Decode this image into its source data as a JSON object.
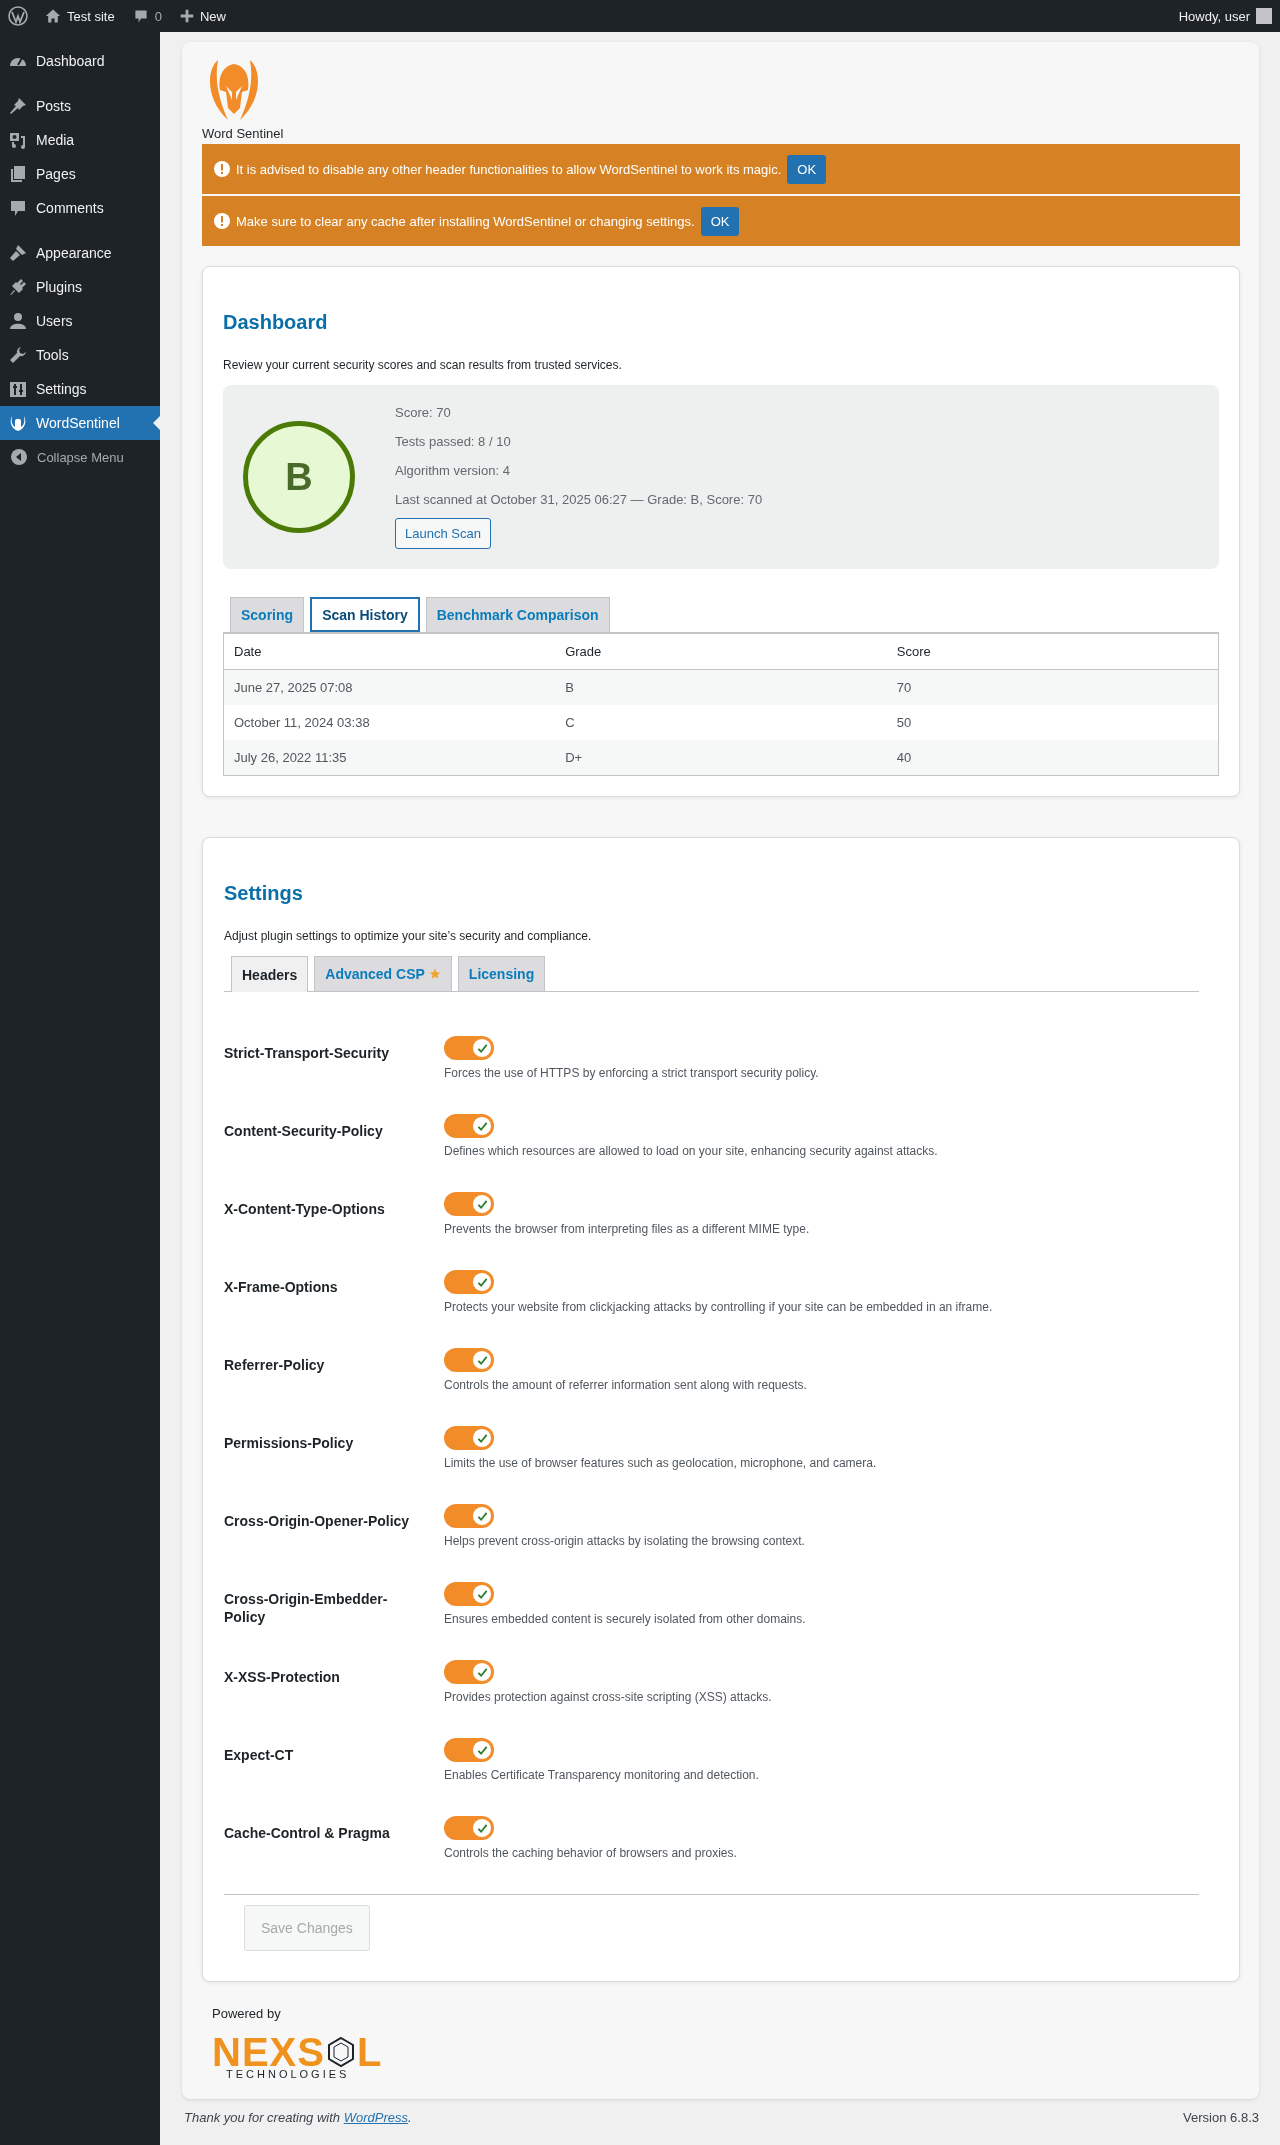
{
  "admin_bar": {
    "site": "Test site",
    "comments": "0",
    "new": "New",
    "greeting": "Howdy, user"
  },
  "sidebar": {
    "groups": [
      [
        {
          "label": "Dashboard",
          "selected": false
        }
      ],
      [
        {
          "label": "Posts",
          "selected": false
        },
        {
          "label": "Media",
          "selected": false
        },
        {
          "label": "Pages",
          "selected": false
        },
        {
          "label": "Comments",
          "selected": false
        }
      ],
      [
        {
          "label": "Appearance",
          "selected": false
        },
        {
          "label": "Plugins",
          "selected": false
        },
        {
          "label": "Users",
          "selected": false
        },
        {
          "label": "Tools",
          "selected": false
        },
        {
          "label": "Settings",
          "selected": false
        },
        {
          "label": "WordSentinel",
          "selected": true
        }
      ]
    ],
    "collapse": "Collapse Menu"
  },
  "brand": {
    "name": "Word Sentinel"
  },
  "notices": [
    {
      "text": "It is advised to disable any other header functionalities to allow WordSentinel to work its magic.",
      "button": "OK"
    },
    {
      "text": "Make sure to clear any cache after installing WordSentinel or changing settings.",
      "button": "OK"
    }
  ],
  "dashboard": {
    "title": "Dashboard",
    "description": "Review your current security scores and scan results from trusted services.",
    "grade": "B",
    "details": [
      "Score: 70",
      "Tests passed: 8 / 10",
      "Algorithm version: 4",
      "Last scanned at October 31, 2025 06:27 — Grade: B, Score: 70"
    ],
    "scan_button": "Launch Scan",
    "tabs": [
      {
        "label": "Scoring",
        "selected": false
      },
      {
        "label": "Scan History",
        "selected": true
      },
      {
        "label": "Benchmark Comparison",
        "selected": false
      }
    ],
    "table": {
      "columns": [
        "Date",
        "Grade",
        "Score"
      ],
      "rows": [
        [
          "June 27, 2025 07:08",
          "B",
          "70"
        ],
        [
          "October 11, 2024 03:38",
          "C",
          "50"
        ],
        [
          "July 26, 2022 11:35",
          "D+",
          "40"
        ]
      ]
    }
  },
  "settings": {
    "title": "Settings",
    "description": "Adjust plugin settings to optimize your site’s security and compliance.",
    "tabs": [
      {
        "label": "Headers",
        "selected": true,
        "starred": false
      },
      {
        "label": "Advanced CSP",
        "selected": false,
        "starred": true
      },
      {
        "label": "Licensing",
        "selected": false,
        "starred": false
      }
    ],
    "headers": [
      {
        "name": "Strict-Transport-Security",
        "on": true,
        "description": "Forces the use of HTTPS by enforcing a strict transport security policy."
      },
      {
        "name": "Content-Security-Policy",
        "on": true,
        "description": "Defines which resources are allowed to load on your site, enhancing security against attacks."
      },
      {
        "name": "X-Content-Type-Options",
        "on": true,
        "description": "Prevents the browser from interpreting files as a different MIME type."
      },
      {
        "name": "X-Frame-Options",
        "on": true,
        "description": "Protects your website from clickjacking attacks by controlling if your site can be embedded in an iframe."
      },
      {
        "name": "Referrer-Policy",
        "on": true,
        "description": "Controls the amount of referrer information sent along with requests."
      },
      {
        "name": "Permissions-Policy",
        "on": true,
        "description": "Limits the use of browser features such as geolocation, microphone, and camera."
      },
      {
        "name": "Cross-Origin-Opener-Policy",
        "on": true,
        "description": "Helps prevent cross-origin attacks by isolating the browsing context."
      },
      {
        "name": "Cross-Origin-Embedder-Policy",
        "on": true,
        "description": "Ensures embedded content is securely isolated from other domains."
      },
      {
        "name": "X-XSS-Protection",
        "on": true,
        "description": "Provides protection against cross-site scripting (XSS) attacks."
      },
      {
        "name": "Expect-CT",
        "on": true,
        "description": "Enables Certificate Transparency monitoring and detection."
      },
      {
        "name": "Cache-Control & Pragma",
        "on": true,
        "description": "Controls the caching behavior of browsers and proxies."
      }
    ],
    "save_button": {
      "label": "Save Changes",
      "disabled": true
    }
  },
  "powered_by": {
    "label": "Powered by",
    "logo_left": "NEXS",
    "logo_right": "L",
    "logo_tagline": "TECHNOLOGIES"
  },
  "footer": {
    "thanks_before": "Thank you for creating with ",
    "link": "WordPress",
    "thanks_after": ".",
    "version": "Version 6.8.3"
  }
}
